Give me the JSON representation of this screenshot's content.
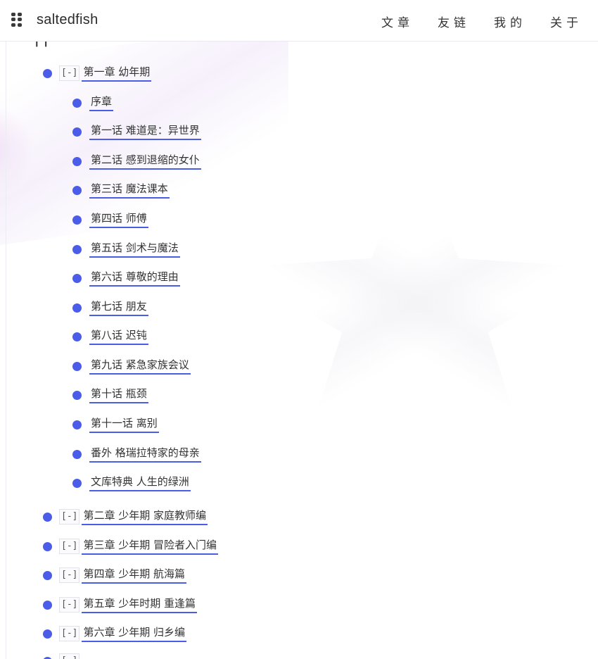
{
  "header": {
    "brand": "saltedfish",
    "nav": [
      "文章",
      "友链",
      "我的",
      "关于"
    ]
  },
  "tree": {
    "toggle": "[-]",
    "chapter1": "第一章 幼年期",
    "sub": [
      "序章",
      "第一话 难道是：异世界",
      "第二话 感到退缩的女仆",
      "第三话 魔法课本",
      "第四话 师傅",
      "第五话 剑术与魔法",
      "第六话 尊敬的理由",
      "第七话 朋友",
      "第八话 迟钝",
      "第九话 紧急家族会议",
      "第十话 瓶颈",
      "第十一话 离别",
      "番外 格瑞拉特家的母亲",
      "文库特典 人生的绿洲"
    ],
    "chapters": [
      "第二章 少年期 家庭教师编",
      "第三章 少年期 冒险者入门编",
      "第四章 少年期 航海篇",
      "第五章 少年时期 重逢篇",
      "第六章 少年期 归乡编"
    ]
  },
  "colors": {
    "accent": "#4a5ce8",
    "text": "#333333",
    "header_bg": "#ffffff"
  },
  "icons": {
    "menu": "grid-menu-icon",
    "bullet": "bullet-dot-icon"
  }
}
